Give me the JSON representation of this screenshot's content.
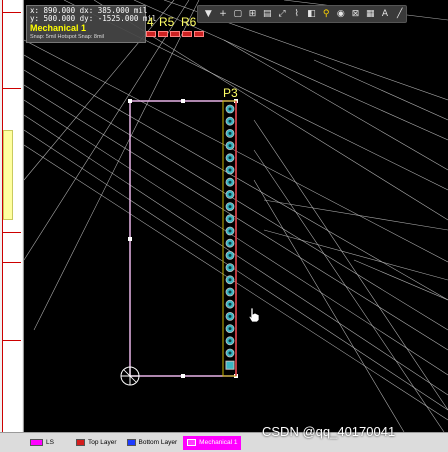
{
  "hud": {
    "x_label": "x:",
    "x_value": "890.000",
    "dx_label": "dx:",
    "dx_value": "385.000 mil",
    "y_label": "y:",
    "y_value": "500.000",
    "dy_label": "dy:",
    "dy_value": "-1525.000 mil",
    "layer": "Mechanical 1",
    "snap": "Snap: 5mil Hotspot Snap: 8mil"
  },
  "designators": {
    "partial": "4",
    "r5": "R5",
    "r6": "R6",
    "p3": "P3"
  },
  "toolbar": {
    "icons": [
      "filter-icon",
      "add-icon",
      "rectangle-select-icon",
      "align-icon",
      "component-icon",
      "route-icon",
      "connection-icon",
      "region-icon",
      "pad-icon",
      "via-icon",
      "dimension-icon",
      "text-icon",
      "line-icon"
    ]
  },
  "layers": {
    "ls": "LS",
    "top": "Top Layer",
    "bottom": "Bottom Layer",
    "mech1": "Mechanical 1"
  },
  "colors": {
    "top_layer": "#d41e1e",
    "bottom_layer": "#1f3cff",
    "mechanical_1": "#ff3cff",
    "ls": "#ff00ff",
    "board_outline": "#e8b4e8",
    "silk_yellow": "#ffff66",
    "pad_teal": "#3ab7c4"
  },
  "watermark": "CSDN @qq_40170041"
}
